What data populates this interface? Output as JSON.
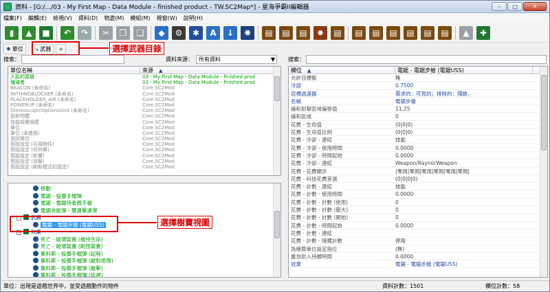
{
  "window": {
    "title": "資料 - [G:/.../03 - My First Map - Data Module - finished product - TW.SC2Map*] - 星海爭霸II編輯器",
    "buttons": {
      "minimize": "–",
      "maximize": "□",
      "close": "✕"
    }
  },
  "menu": [
    "檔案(F)",
    "編輯(E)",
    "檢視(V)",
    "資料(D)",
    "物遊(M)",
    "模組(M)",
    "視窗(W)",
    "說明(H)"
  ],
  "toolbar": {
    "groups": [
      [
        {
          "name": "new-icon",
          "color": "#2e8b2e",
          "glyph": "▮"
        },
        {
          "name": "open-icon",
          "color": "#2e8b2e",
          "glyph": "▲"
        },
        {
          "name": "save-icon",
          "color": "#1e7a30",
          "glyph": "■"
        }
      ],
      [
        {
          "name": "undo-icon",
          "color": "#2e8b2e",
          "glyph": "↶"
        },
        {
          "name": "redo-icon",
          "color": "#9aa",
          "glyph": "↷"
        }
      ],
      [
        {
          "name": "cut-icon",
          "color": "#9aa0a6",
          "glyph": "✂"
        },
        {
          "name": "copy-icon",
          "color": "#9aa0a6",
          "glyph": "❐"
        },
        {
          "name": "paste-icon",
          "color": "#9aa0a6",
          "glyph": "❏"
        }
      ],
      [
        {
          "name": "terrain-icon",
          "color": "#2a6fc9",
          "glyph": "◆"
        },
        {
          "name": "trigger-icon",
          "color": "#3a3a3a",
          "glyph": "⚙"
        },
        {
          "name": "data-icon",
          "color": "#1e4f9c",
          "glyph": "✱"
        },
        {
          "name": "text-icon",
          "color": "#2a6fc9",
          "glyph": "A"
        },
        {
          "name": "import-icon",
          "color": "#2a6fc9",
          "glyph": "↓"
        },
        {
          "name": "ai-icon",
          "color": "#1e3f7c",
          "glyph": "✺"
        }
      ],
      [
        {
          "name": "module-1-icon",
          "color": "#7a4a10",
          "glyph": "▤"
        },
        {
          "name": "module-2-icon",
          "color": "#7a4a10",
          "glyph": "▤"
        },
        {
          "name": "module-3-icon",
          "color": "#7a4a10",
          "glyph": "▤"
        },
        {
          "name": "module-4-icon",
          "color": "#8a3a10",
          "glyph": "✹"
        },
        {
          "name": "module-5-icon",
          "color": "#7a4a10",
          "glyph": "▤"
        }
      ],
      [
        {
          "name": "module-6-icon",
          "color": "#7a4a10",
          "glyph": "▤"
        },
        {
          "name": "module-7-icon",
          "color": "#7a4a10",
          "glyph": "▤"
        },
        {
          "name": "module-8-icon",
          "color": "#7a4a10",
          "glyph": "▤"
        },
        {
          "name": "module-9-icon",
          "color": "#7a4a10",
          "glyph": "▤"
        },
        {
          "name": "module-10-icon",
          "color": "#7a4a10",
          "glyph": "▤"
        },
        {
          "name": "module-11-icon",
          "color": "#7a4a10",
          "glyph": "▤"
        }
      ],
      [
        {
          "name": "test-icon",
          "color": "#9aa0a6",
          "glyph": "▲"
        },
        {
          "name": "launch-icon",
          "color": "#1e7a30",
          "glyph": "✚"
        }
      ]
    ]
  },
  "left": {
    "tab_unit": "單位",
    "tab_weapon": "武器",
    "add_glyph": "+",
    "search_label": "搜索：",
    "source_label": "資料來源：",
    "source_value": "所有資料",
    "col_name": "單位名稱",
    "col_source": "來源",
    "rows": [
      {
        "name": "人民的英雄",
        "source": "03 - My First Map - Data Module - finished prod",
        "green": true
      },
      {
        "name": "殲滅者",
        "source": "03 - My First Map - Data Module - finished prod",
        "green": true
      },
      {
        "name": "BEACON (未命名)",
        "source": "Core.SC2Mod",
        "green": false
      },
      {
        "name": "PATHINGBLOCKER (未命名)",
        "source": "Core.SC2Mod",
        "green": false
      },
      {
        "name": "PLACEHOLDER_AIR (未命名)",
        "source": "Core.SC2Mod",
        "green": false
      },
      {
        "name": "POWERUP (未命名)",
        "source": "Core.SC2Mod",
        "green": false
      },
      {
        "name": "StereoscopicOptionsUnit (未命名)",
        "source": "Core.SC2Mod",
        "green": false
      },
      {
        "name": "投射物體",
        "source": "Core.SC2Mod",
        "green": false
      },
      {
        "name": "技能視覺規模",
        "source": "Core.SC2Mod",
        "green": false
      },
      {
        "name": "單位",
        "source": "Core.SC2Mod",
        "green": false
      },
      {
        "name": "單位 (未使用)",
        "source": "Core.SC2Mod",
        "green": false
      },
      {
        "name": "測試單位",
        "source": "Core.SC2Mod",
        "green": false
      },
      {
        "name": "預設設定 (可視物件)",
        "source": "Core.SC2Mod",
        "green": false
      },
      {
        "name": "預設設定 (任何單)",
        "source": "Core.SC2Mod",
        "green": false
      },
      {
        "name": "預設設定 (影響)",
        "source": "Core.SC2Mod",
        "green": false
      },
      {
        "name": "預設設定 (攻擊)",
        "source": "Core.SC2Mod",
        "green": false
      },
      {
        "name": "預設設定 (刷新模式的設定)",
        "source": "Core.SC2Mod",
        "green": false
      }
    ]
  },
  "tree": {
    "rows": [
      {
        "indent": 36,
        "label": "移動",
        "kind": "node",
        "expander": "",
        "color": "green",
        "sel": false
      },
      {
        "indent": 36,
        "label": "電鋸 - 投擲手榴彈",
        "kind": "leaf",
        "expander": "",
        "color": "green",
        "sel": false
      },
      {
        "indent": 36,
        "label": "電鋸 - 電鋸持者親手槍",
        "kind": "leaf",
        "expander": "",
        "color": "green",
        "sel": false
      },
      {
        "indent": 36,
        "label": "電鋸充能彈 - 雙連擊連彈",
        "kind": "leaf",
        "expander": "",
        "color": "green",
        "sel": false
      },
      {
        "indent": 12,
        "label": "武器",
        "kind": "folder",
        "expander": "–",
        "color": "blue",
        "sel": false
      },
      {
        "indent": 36,
        "label": "電鋸 - 電鋸步槍 (電鋸USS)",
        "kind": "leaf",
        "expander": "",
        "color": "green",
        "sel": true
      },
      {
        "indent": 12,
        "label": "效果",
        "kind": "folder",
        "expander": "–",
        "color": "blue",
        "sel": false
      },
      {
        "indent": 36,
        "label": "死亡 - 破壞裝置 (維持生命)",
        "kind": "leaf",
        "expander": "",
        "color": "green",
        "sel": false
      },
      {
        "indent": 36,
        "label": "死亡 - 破壞裝置 (刷怪裝置)",
        "kind": "leaf",
        "expander": "",
        "color": "green",
        "sel": false
      },
      {
        "indent": 36,
        "label": "集料斯 - 投擲手榴彈 (起程)",
        "kind": "leaf",
        "expander": "",
        "color": "green",
        "sel": false
      },
      {
        "indent": 36,
        "label": "集料斯 - 投擲手榴彈 (敵對搭傷)",
        "kind": "leaf",
        "expander": "",
        "color": "green",
        "sel": false
      },
      {
        "indent": 36,
        "label": "集料斯 - 投擲手榴彈 (敵擊)",
        "kind": "leaf",
        "expander": "",
        "color": "green",
        "sel": false
      },
      {
        "indent": 36,
        "label": "集料斯 - 投擲手榴彈 (延遲)",
        "kind": "leaf",
        "expander": "",
        "color": "green",
        "sel": false
      }
    ]
  },
  "right": {
    "search_label": "搜索：",
    "col_field": "欄位",
    "col_value": "電鋸 - 電鋸步槍 (電鋸USS)",
    "rows": [
      {
        "name": "允許目標幫",
        "value": "無",
        "blue": false
      },
      {
        "name": "冷卻",
        "value": "0.7500",
        "blue": true
      },
      {
        "name": "目標過濾器",
        "value": "需求的：可見的；排除的：殘骸，",
        "blue": true
      },
      {
        "name": "名稱",
        "value": "電鋸步槍",
        "blue": true
      },
      {
        "name": "緩和射擊區域偏移值",
        "value": "11.25",
        "blue": false
      },
      {
        "name": "緩和區域",
        "value": "0",
        "blue": false
      },
      {
        "name": "花費 - 生命值",
        "value": "(0|0|0)",
        "blue": false
      },
      {
        "name": "花費 - 生命值比例",
        "value": "(0|0|0)",
        "blue": false
      },
      {
        "name": "花費 - 冷卻 - 連結",
        "value": "技能",
        "blue": false
      },
      {
        "name": "花費 - 冷卻 - 使用時間",
        "value": "0.0000",
        "blue": false
      },
      {
        "name": "花費 - 冷卻 - 時間起始",
        "value": "0.0000",
        "blue": false
      },
      {
        "name": "花費 - 冷卻 - 連結",
        "value": "Weapon/RaynorWeapon",
        "blue": false
      },
      {
        "name": "花費 - 花費顯示",
        "value": "(零用|零用|零用|零用|零用|零用|",
        "blue": false
      },
      {
        "name": "花費 - 科技花費首選",
        "value": "(0|0|0|0)",
        "blue": false
      },
      {
        "name": "花費 - 計數 - 連結",
        "value": "技能",
        "blue": false
      },
      {
        "name": "花費 - 計數 - 使用時間",
        "value": "0.0000",
        "blue": false
      },
      {
        "name": "花費 - 計數 - 計數 (使用)",
        "value": "0",
        "blue": false
      },
      {
        "name": "花費 - 計數 - 計數 (最大)",
        "value": "0",
        "blue": false
      },
      {
        "name": "花費 - 計數 - 計數 (開始)",
        "value": "0",
        "blue": false
      },
      {
        "name": "花費 - 計數 - 時間起始",
        "value": "0.0000",
        "blue": false
      },
      {
        "name": "花費 - 計數 - 連結",
        "value": "",
        "blue": false
      },
      {
        "name": "花費 - 計數 - 隱藏計數",
        "value": "停用",
        "blue": false
      },
      {
        "name": "為確算單位設定指位",
        "value": "(無)",
        "blue": false
      },
      {
        "name": "重划射入持續時間",
        "value": "0.0000",
        "blue": false
      },
      {
        "name": "效果",
        "value": "電鋸 - 電鋸步槍 (電鋸USS)",
        "blue": true
      }
    ]
  },
  "annotations": {
    "weapon_dir": "選擇武器目錄",
    "tree_view": "選擇樹寶視圖"
  },
  "status": {
    "message": "單位：出現是遊戲世界中，並受遊戲動作的物件",
    "data_count": "資料計數：1501",
    "field_count": "欄位計數：58"
  }
}
